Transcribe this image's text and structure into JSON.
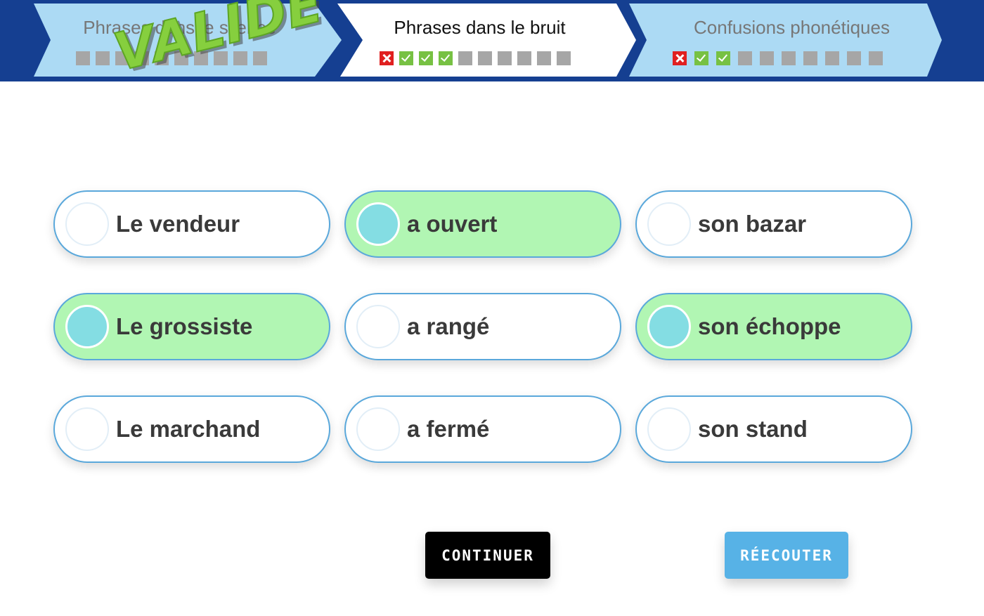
{
  "steps": [
    {
      "title": "Phrases dans le silence",
      "state": "done",
      "stamp": "VALIDÉ",
      "marks": [
        "empty",
        "empty",
        "empty",
        "empty",
        "empty",
        "empty",
        "empty",
        "empty",
        "empty",
        "empty"
      ]
    },
    {
      "title": "Phrases dans le bruit",
      "state": "active",
      "marks": [
        "wrong",
        "correct",
        "correct",
        "correct",
        "empty",
        "empty",
        "empty",
        "empty",
        "empty",
        "empty"
      ]
    },
    {
      "title": "Confusions phonétiques",
      "state": "pending",
      "marks": [
        "wrong",
        "correct",
        "correct",
        "empty",
        "empty",
        "empty",
        "empty",
        "empty",
        "empty",
        "empty"
      ]
    }
  ],
  "choices": [
    {
      "label": "Le vendeur",
      "selected": false
    },
    {
      "label": "a ouvert",
      "selected": true
    },
    {
      "label": "son bazar",
      "selected": false
    },
    {
      "label": "Le grossiste",
      "selected": true
    },
    {
      "label": "a rangé",
      "selected": false
    },
    {
      "label": "son échoppe",
      "selected": true
    },
    {
      "label": "Le marchand",
      "selected": false
    },
    {
      "label": "a fermé",
      "selected": false
    },
    {
      "label": "son stand",
      "selected": false
    }
  ],
  "buttons": {
    "continue_label": "CONTINUER",
    "replay_label": "RÉECOUTER"
  },
  "colors": {
    "header_bg": "#153f91",
    "step_bg": "#acdaf4",
    "step_active_bg": "#ffffff",
    "selected_bg": "#b1f6b3",
    "radio_selected": "#84dde3",
    "choice_border": "#5aa8db",
    "mark_correct": "#77c143",
    "mark_wrong": "#e02020",
    "mark_empty": "#a6a6a6",
    "stamp": "#86cf3e",
    "continue_bg": "#000000",
    "replay_bg": "#57b2e6"
  }
}
